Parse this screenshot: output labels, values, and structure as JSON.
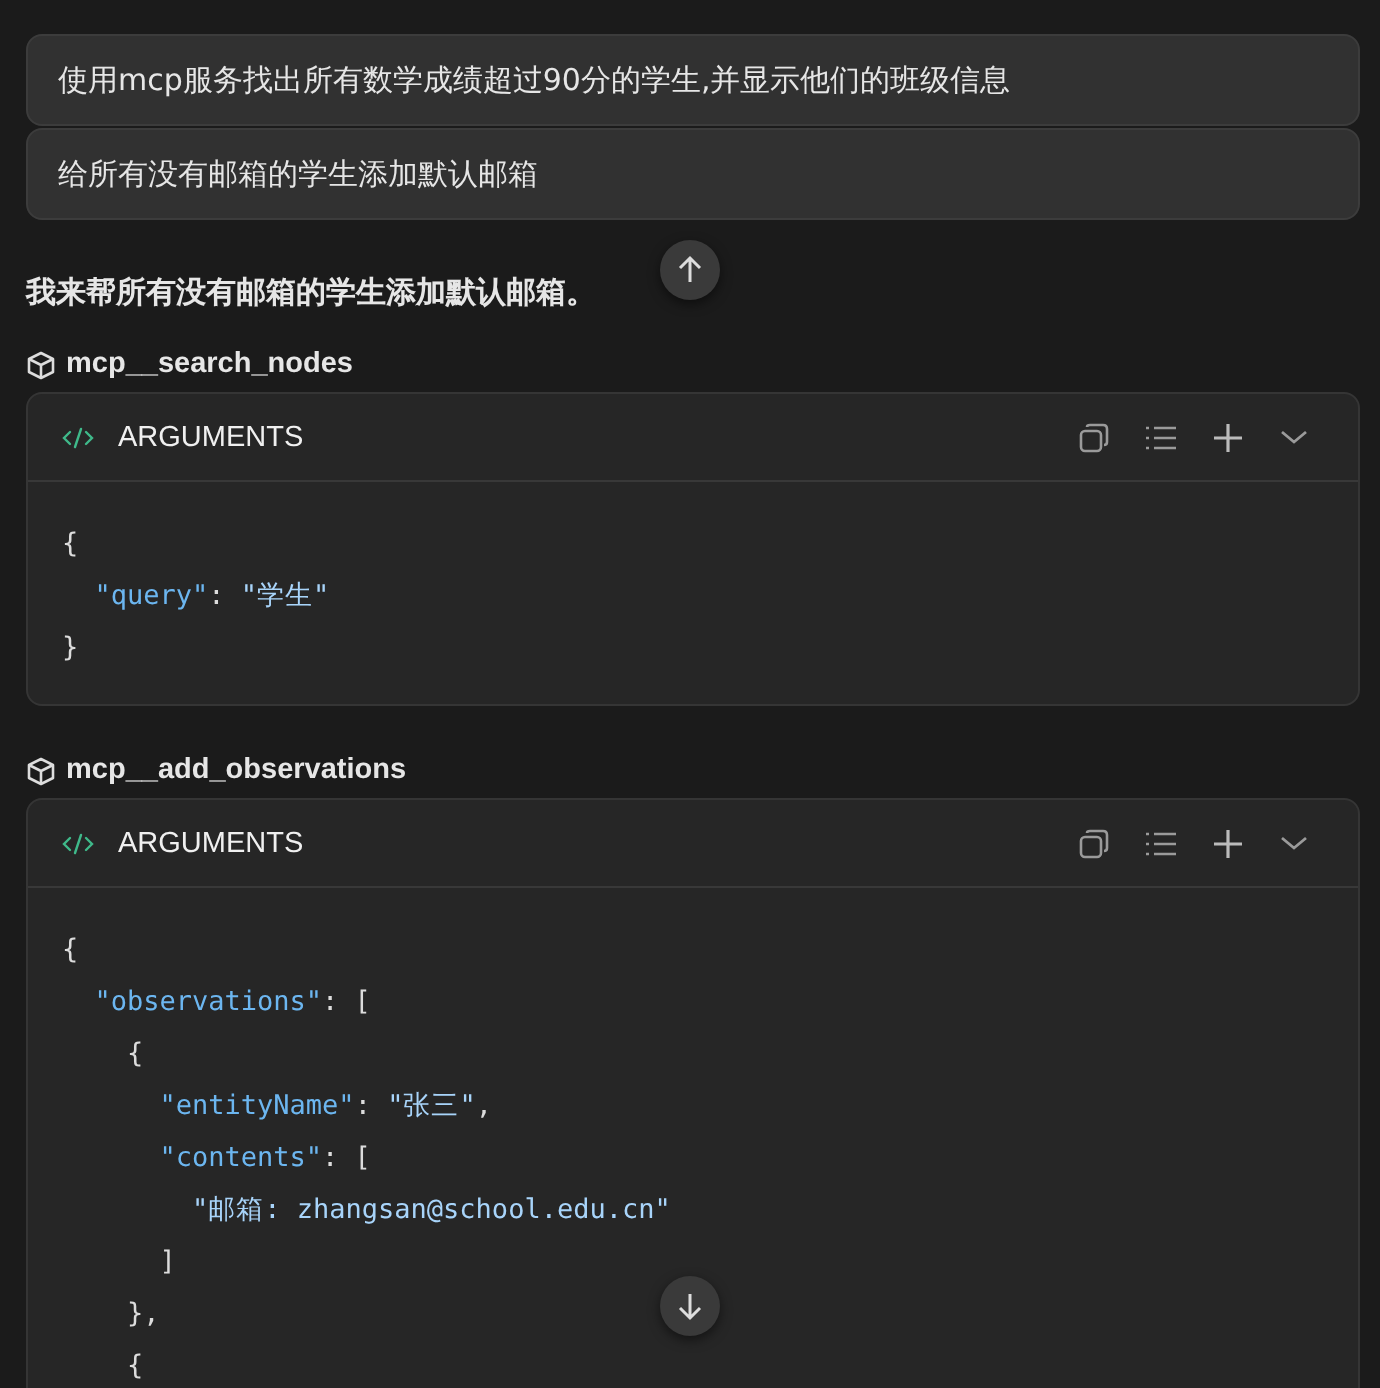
{
  "user_messages": [
    {
      "text": "使用mcp服务找出所有数学成绩超过90分的学生,并显示他们的班级信息"
    },
    {
      "text": "给所有没有邮箱的学生添加默认邮箱"
    }
  ],
  "assistant_text": "我来帮所有没有邮箱的学生添加默认邮箱。",
  "tool_calls": [
    {
      "name": "mcp__search_nodes",
      "header": "ARGUMENTS",
      "expanded": false,
      "lines": [
        [
          {
            "kind": "punct",
            "text": "{"
          }
        ],
        [
          {
            "kind": "key",
            "text": "  \"query\""
          },
          {
            "kind": "punct",
            "text": ": "
          },
          {
            "kind": "string",
            "text": "\"学生\""
          }
        ],
        [
          {
            "kind": "punct",
            "text": "}"
          }
        ]
      ]
    },
    {
      "name": "mcp__add_observations",
      "header": "ARGUMENTS",
      "expanded": false,
      "lines": [
        [
          {
            "kind": "punct",
            "text": "{"
          }
        ],
        [
          {
            "kind": "key",
            "text": "  \"observations\""
          },
          {
            "kind": "punct",
            "text": ": ["
          }
        ],
        [
          {
            "kind": "punct",
            "text": "    {"
          }
        ],
        [
          {
            "kind": "key",
            "text": "      \"entityName\""
          },
          {
            "kind": "punct",
            "text": ": "
          },
          {
            "kind": "string",
            "text": "\"张三\""
          },
          {
            "kind": "punct",
            "text": ","
          }
        ],
        [
          {
            "kind": "key",
            "text": "      \"contents\""
          },
          {
            "kind": "punct",
            "text": ": ["
          }
        ],
        [
          {
            "kind": "string",
            "text": "        \"邮箱: zhangsan@school.edu.cn\""
          }
        ],
        [
          {
            "kind": "punct",
            "text": "      ]"
          }
        ],
        [
          {
            "kind": "punct",
            "text": "    },"
          }
        ],
        [
          {
            "kind": "punct",
            "text": "    {"
          }
        ]
      ]
    }
  ]
}
